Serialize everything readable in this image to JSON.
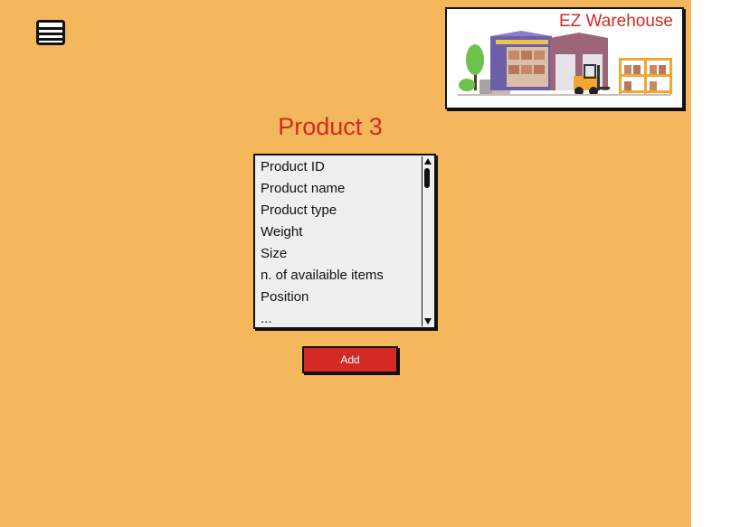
{
  "header": {
    "menu_icon": "hamburger-menu-icon",
    "logo": {
      "title": "EZ Warehouse",
      "illustration": "warehouse-illustration"
    }
  },
  "main": {
    "title": "Product 3",
    "attributes": [
      "Product ID",
      "Product name",
      "Product type",
      "Weight",
      "Size",
      "n. of availaible items",
      "Position",
      "..."
    ],
    "add_label": "Add"
  },
  "colors": {
    "background": "#f4b75c",
    "accent": "#d32a24",
    "list_background": "#efefef",
    "outline": "#111111"
  }
}
